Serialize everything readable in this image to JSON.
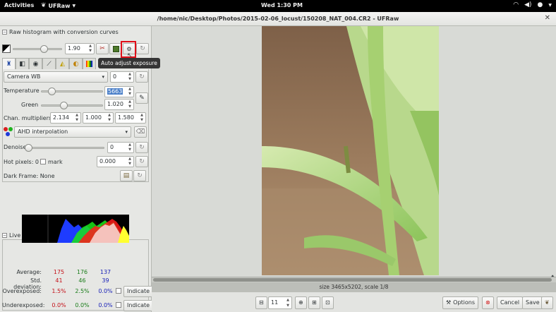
{
  "topbar": {
    "activities": "Activities",
    "app": "UFRaw",
    "clock": "Wed  1:30 PM"
  },
  "window": {
    "title": "/home/nic/Desktop/Photos/2015-02-06_locust/150208_NAT_004.CR2 - UFRaw"
  },
  "raw_histogram": {
    "header": "Raw histogram with conversion curves"
  },
  "exposure": {
    "value": "1.90"
  },
  "tooltip": {
    "text": "Auto adjust exposure"
  },
  "white_balance": {
    "preset": "Camera WB",
    "preset_value": "0",
    "temperature_label": "Temperature",
    "temperature_value": "5663",
    "green_label": "Green",
    "green_value": "1.020"
  },
  "multipliers": {
    "label": "Chan. multipliers:",
    "r": "2.134",
    "g": "1.000",
    "b": "1.580"
  },
  "interpolation": {
    "value": "AHD interpolation"
  },
  "denoise": {
    "label": "Denoise",
    "value": "0"
  },
  "hot_pixels": {
    "label": "Hot pixels: 0",
    "mark_label": "mark",
    "value": "0.000"
  },
  "dark_frame": {
    "label": "Dark Frame: None"
  },
  "live_histogram": {
    "header": "Live histogram"
  },
  "stats": {
    "average_label": "Average:",
    "average": [
      "175",
      "176",
      "137"
    ],
    "std_label": "Std. deviation:",
    "std": [
      "41",
      "46",
      "39"
    ],
    "over_label": "Overexposed:",
    "over": [
      "1.5%",
      "2.5%",
      "0.0%"
    ],
    "under_label": "Underexposed:",
    "under": [
      "0.0%",
      "0.0%",
      "0.0%"
    ],
    "indicate_label": "Indicate"
  },
  "status": {
    "text": "size 3465x5202, scale 1/8"
  },
  "bottom": {
    "zoom": "11",
    "options": "Options",
    "cancel": "Cancel",
    "save": "Save"
  },
  "colors": {
    "highlight": "#e0101a"
  }
}
